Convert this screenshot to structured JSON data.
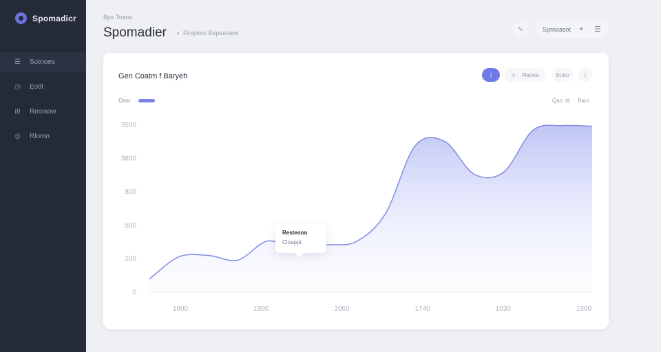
{
  "app": {
    "name": "Spomadicr"
  },
  "sidebar": {
    "items": [
      {
        "label": "Sotnoes",
        "icon": "list-icon",
        "glyph": "☰",
        "active": true
      },
      {
        "label": "Eotlt",
        "icon": "clock-icon",
        "glyph": "◷",
        "active": false
      },
      {
        "label": "Reoisow",
        "icon": "grid-icon",
        "glyph": "⊞",
        "active": false
      },
      {
        "label": "Rlomn",
        "icon": "globe-icon",
        "glyph": "◎",
        "active": false
      }
    ]
  },
  "header": {
    "breadcrumb": "Bps Toaos",
    "title": "Spomadier",
    "subtitle": "Fimpkos Bepsetsew",
    "icon_glyph": "✎",
    "select_label": "Sprnoasot",
    "select_chev": "▾",
    "menu_glyph": "☰"
  },
  "card": {
    "title": "Gen Coatm f Baryeh",
    "segments": {
      "a": "⟩",
      "b_icon": "⊃",
      "b": "Reone",
      "c": "Bobo",
      "d": "⟩"
    },
    "legend_label": "Ceor",
    "range_a": "Qao",
    "range_a_icon": "⊟",
    "range_b": "Baro"
  },
  "tooltip": {
    "line1": "Resteoon",
    "line2": "Cloappt."
  },
  "accent": "#6f7ae6",
  "chart_data": {
    "type": "area",
    "y_ticks": [
      "3500",
      "3800",
      "800",
      "500",
      "200",
      "0"
    ],
    "x_ticks": [
      "1900",
      "1900",
      "1060",
      "1740",
      "1030",
      "1900"
    ],
    "series": [
      {
        "values": [
          20,
          54,
          56,
          49,
          78,
          65,
          72,
          77,
          120,
          223,
          230,
          180,
          183,
          247,
          254,
          253
        ]
      }
    ],
    "ylim": [
      0,
      260
    ],
    "grid": false
  }
}
